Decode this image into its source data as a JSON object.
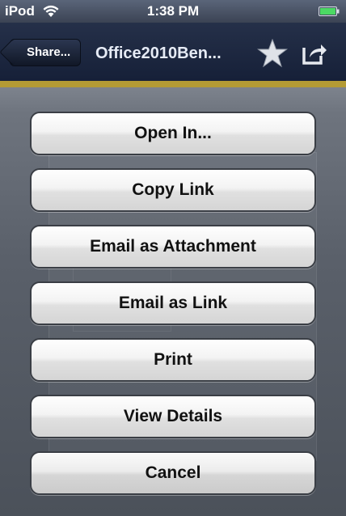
{
  "status_bar": {
    "carrier": "iPod",
    "time": "1:38 PM"
  },
  "nav_bar": {
    "back_label": "Share...",
    "title": "Office2010Ben..."
  },
  "action_sheet": {
    "buttons": [
      {
        "label": "Open In..."
      },
      {
        "label": "Copy Link"
      },
      {
        "label": "Email as Attachment"
      },
      {
        "label": "Email as Link"
      },
      {
        "label": "Print"
      },
      {
        "label": "View Details"
      }
    ],
    "cancel_label": "Cancel"
  },
  "icons": {
    "wifi": "wifi-icon",
    "battery": "battery-icon",
    "back": "back-chevron",
    "favorite": "star-icon",
    "share": "share-icon"
  },
  "colors": {
    "nav_bar": "#1d2740",
    "accent_strip": "#b49b35",
    "sheet_background": "#5a606a",
    "button_face": "#f0f0f0",
    "battery": "#4cd964"
  }
}
